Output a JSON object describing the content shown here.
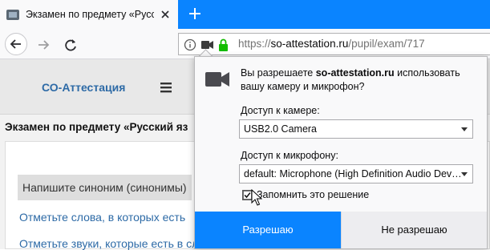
{
  "tab": {
    "title": "Экзамен по предмету «Русский"
  },
  "navbar": {
    "url_scheme": "https://",
    "url_host": "so-attestation.ru",
    "url_path": "/pupil/exam/717"
  },
  "site": {
    "brand": "СО-Аттестация",
    "exam_title": "Экзамен по предмету «Русский яз",
    "questions": [
      "Напишите синоним (синонимы)",
      "Отметьте слова, в которых есть",
      "Отметьте звуки, которые есть в слове ШЛЯПА."
    ],
    "right_fragment": "с"
  },
  "permission_panel": {
    "question_prefix": "Вы разрешаете ",
    "question_host": "so-attestation.ru",
    "question_suffix": " использовать вашу камеру и микрофон?",
    "camera_label": "Доступ к камере:",
    "camera_value": "USB2.0 Camera",
    "mic_label": "Доступ к микрофону:",
    "mic_value": "default: Microphone (High Definition Audio Dev…",
    "remember_label": "Запомнить это решение",
    "remember_checked": true,
    "allow_label": "Разрешаю",
    "deny_label": "Не разрешаю"
  },
  "colors": {
    "accent": "#0a84ff",
    "brand": "#2d6aa6",
    "secure_lock": "#12bc00"
  }
}
